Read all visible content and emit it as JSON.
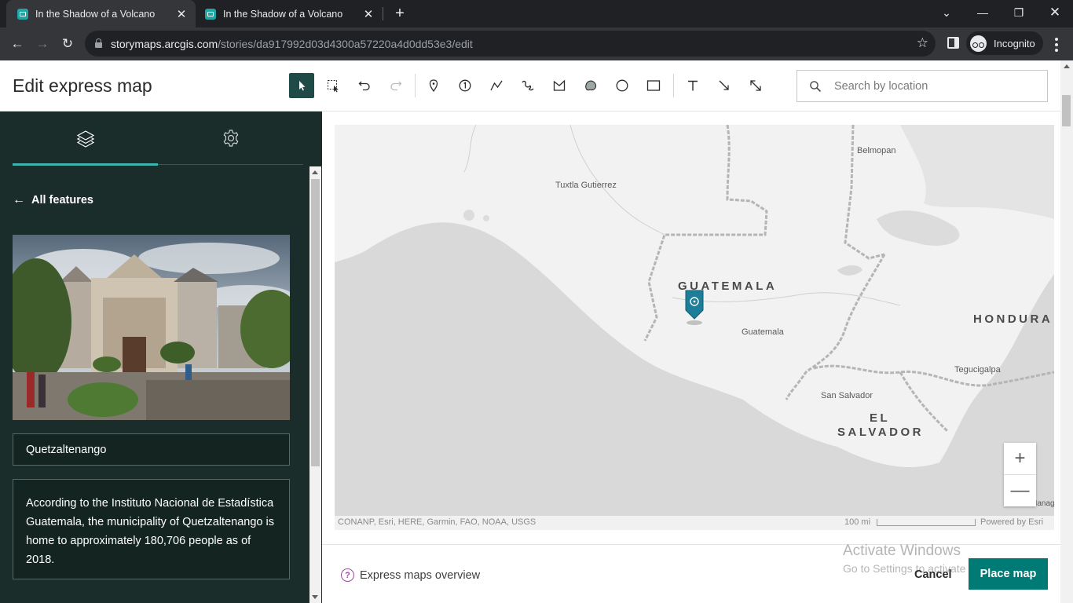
{
  "browser": {
    "tabs": [
      {
        "title": "In the Shadow of a Volcano",
        "active": true
      },
      {
        "title": "In the Shadow of a Volcano",
        "active": false
      }
    ],
    "url_host": "storymaps.arcgis.com",
    "url_path": "/stories/da917992d03d4300a57220a4d0dd53e3/edit",
    "profile_label": "Incognito"
  },
  "header": {
    "title": "Edit express map",
    "search_placeholder": "Search by location"
  },
  "panel": {
    "back_label": "All features",
    "feature_name": "Quetzaltenango",
    "feature_description": "According to the Instituto Nacional de Estadística Guatemala, the municipality of Quetzaltenango is home to approximately 180,706 people as of 2018."
  },
  "map": {
    "labels": {
      "belmopan": "Belmopan",
      "tuxtla": "Tuxtla Gutierrez",
      "guatemala_country": "GUATEMALA",
      "guatemala_city": "Guatemala",
      "honduras": "HONDURA",
      "tegucigalpa": "Tegucigalpa",
      "san_salvador": "San Salvador",
      "el_salvador_1": "EL",
      "el_salvador_2": "SALVADOR",
      "managua_partial": "Manag"
    },
    "attribution": "CONANP, Esri, HERE, Garmin, FAO, NOAA, USGS",
    "scale_label": "100 mi",
    "powered_by": "Powered by Esri",
    "zoom_in": "+",
    "zoom_out": "—"
  },
  "footer": {
    "help_label": "Express maps overview",
    "help_icon": "?",
    "cancel_label": "Cancel",
    "place_label": "Place map"
  },
  "os_watermark": {
    "line1": "Activate Windows",
    "line2": "Go to Settings to activate Windows."
  },
  "colors": {
    "panel_bg": "#1a2d2b",
    "accent": "#007a75",
    "pin": "#1d7e9a",
    "tab_indicator": "#3fb3ad"
  }
}
